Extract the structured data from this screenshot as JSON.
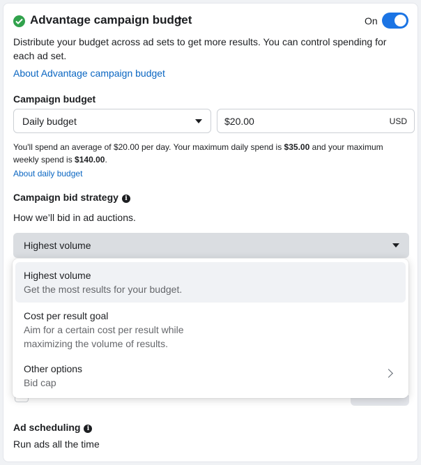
{
  "header": {
    "title": "Advantage campaign budget",
    "sparkle": "✦",
    "toggle_label": "On",
    "toggle_on": true,
    "description": "Distribute your budget across ad sets to get more results. You can control spending for each ad set.",
    "about_link": "About Advantage campaign budget",
    "status_color": "#31a24c",
    "accent_color": "#1b74e4"
  },
  "budget": {
    "label": "Campaign budget",
    "type_selected": "Daily budget",
    "amount": "$20.00",
    "currency": "USD",
    "note_prefix": "You'll spend an average of $20.00 per day. Your maximum daily spend is ",
    "max_daily": "$35.00",
    "note_middle": " and your maximum weekly spend is ",
    "max_weekly": "$140.00",
    "note_suffix": ".",
    "about_link": "About daily budget"
  },
  "bid_strategy": {
    "label": "Campaign bid strategy",
    "info_icon": "i",
    "subtitle": "How we’ll bid in ad auctions.",
    "selected": "Highest volume",
    "options": [
      {
        "title": "Highest volume",
        "description": "Get the most results for your budget."
      },
      {
        "title": "Cost per result goal",
        "description_line1": "Aim for a certain cost per result while",
        "description_line2": "maximizing the volume of results."
      },
      {
        "title": "Other options",
        "description": "Bid cap"
      }
    ]
  },
  "scheduling": {
    "label": "Ad scheduling",
    "info_icon": "i",
    "value": "Run ads all the time"
  }
}
